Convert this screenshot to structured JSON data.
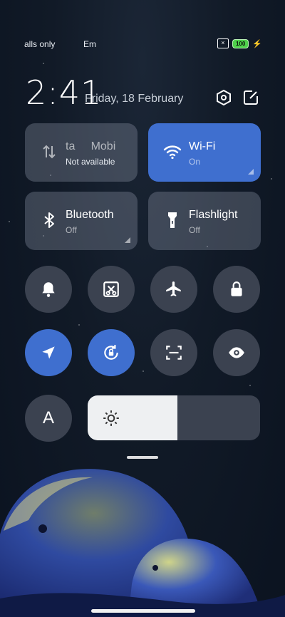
{
  "status": {
    "left1": "alls only",
    "left2": "Em",
    "battery": "100"
  },
  "header": {
    "time": "2:41",
    "date": "Friday, 18 February"
  },
  "tiles": {
    "data": {
      "title": "ta     Mobi",
      "subtitle": "Not available",
      "on": false
    },
    "wifi": {
      "title": "Wi-Fi",
      "subtitle": "On",
      "on": true
    },
    "bluetooth": {
      "title": "Bluetooth",
      "subtitle": "Off",
      "on": false
    },
    "flashlight": {
      "title": "Flashlight",
      "subtitle": "Off",
      "on": false
    }
  },
  "toggles": {
    "font_label": "A"
  },
  "brightness": {
    "level": 0.52
  },
  "colors": {
    "accent": "#3f6fcf",
    "tile_off": "#3b4250"
  },
  "icons": [
    "settings-icon",
    "edit-icon",
    "mobile-data-icon",
    "wifi-icon",
    "bluetooth-icon",
    "flashlight-icon",
    "bell-icon",
    "screenshot-icon",
    "airplane-icon",
    "lock-icon",
    "location-icon",
    "auto-rotate-icon",
    "scan-icon",
    "eye-icon",
    "sun-icon"
  ]
}
